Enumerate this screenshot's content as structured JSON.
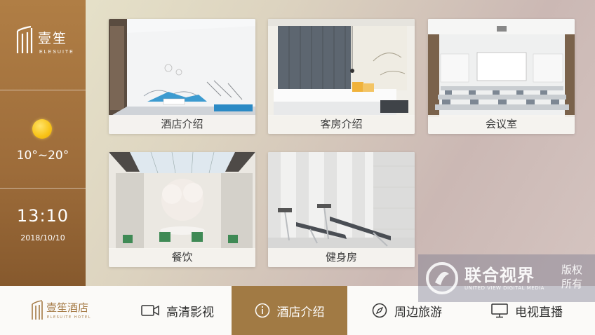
{
  "sidebar": {
    "logo_cn": "壹笙",
    "logo_en": "ELESUITE",
    "weather_icon": "sun-icon",
    "temperature": "10°~20°",
    "time": "13:10",
    "date": "2018/10/10"
  },
  "cards": [
    {
      "label": "酒店介绍",
      "icon": "lobby-photo"
    },
    {
      "label": "客房介绍",
      "icon": "guestroom-photo"
    },
    {
      "label": "会议室",
      "icon": "meeting-room-photo"
    },
    {
      "label": "餐饮",
      "icon": "dining-photo"
    },
    {
      "label": "健身房",
      "icon": "gym-photo"
    }
  ],
  "bottom_nav": {
    "brand_cn": "壹笙酒店",
    "brand_en": "ELESUITE HOTEL",
    "items": [
      {
        "label": "高清影视",
        "icon": "video-camera-icon"
      },
      {
        "label": "酒店介绍",
        "icon": "info-icon",
        "active": true
      },
      {
        "label": "周边旅游",
        "icon": "compass-icon"
      },
      {
        "label": "电视直播",
        "icon": "tv-icon"
      }
    ],
    "active_color": "#a17a44"
  },
  "watermark": {
    "title": "联合视界",
    "subtitle": "UNITED VIEW DIGITAL MEDIA",
    "rights": "版权所有"
  }
}
